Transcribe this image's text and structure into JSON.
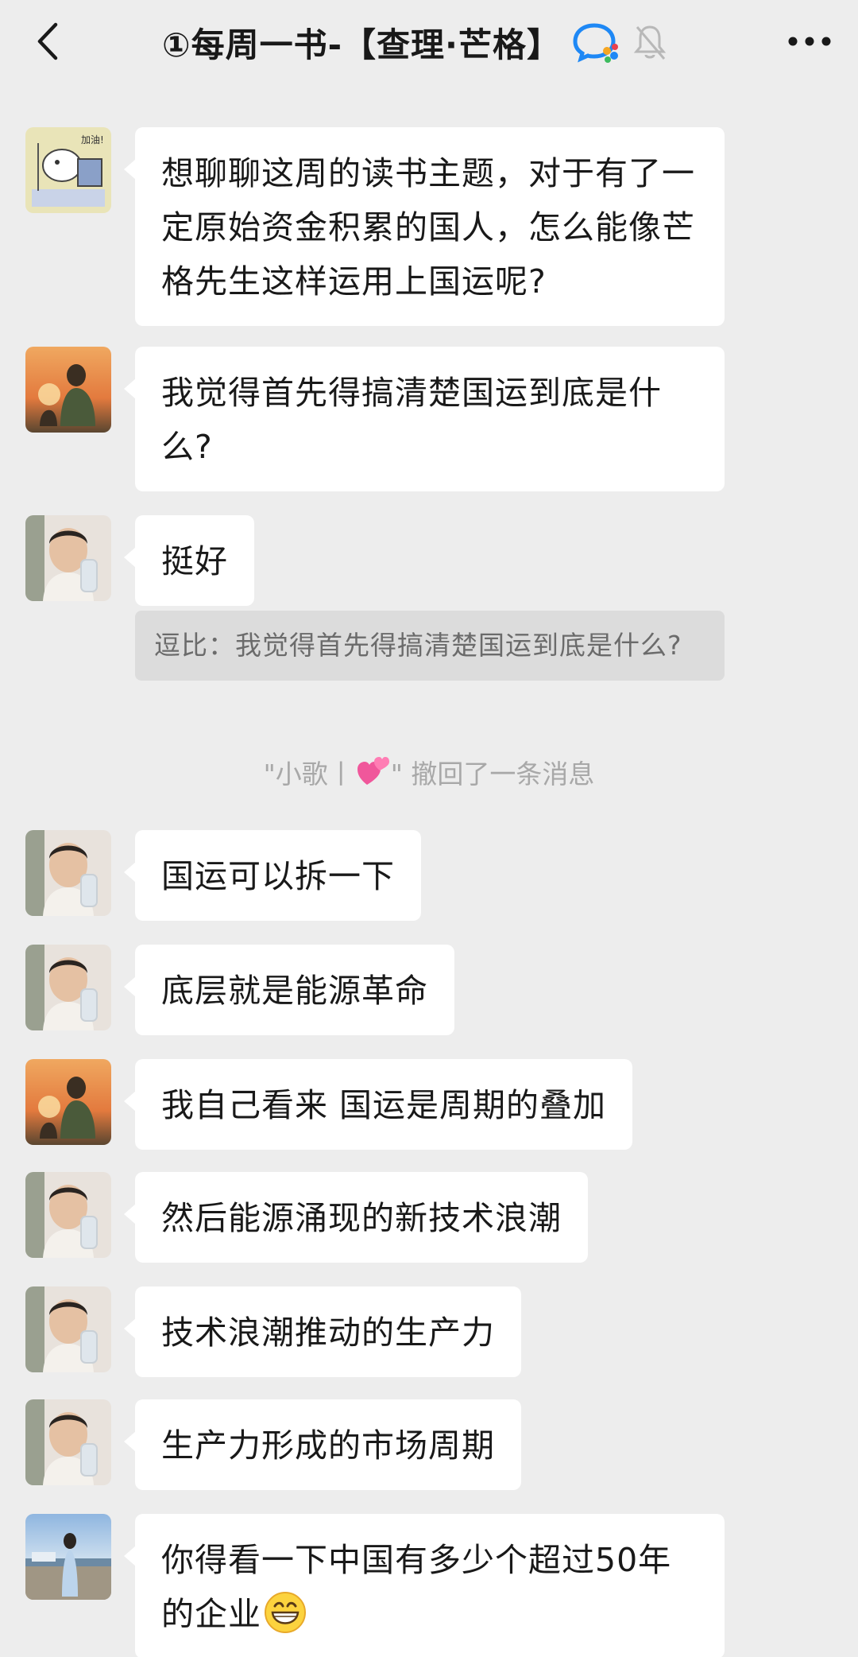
{
  "header": {
    "title": "①每周一书-【查理·芒格】",
    "back_icon": "chevron-left-icon",
    "enterprise_icon": "wecom-chat-icon",
    "mute_icon": "bell-muted-icon",
    "more_icon": "more-horizontal-icon"
  },
  "messages": [
    {
      "sender": "group-member-cartoon",
      "text": "想聊聊这周的读书主题，对于有了一定原始资金积累的国人，怎么能像芒格先生这样运用上国运呢?"
    },
    {
      "sender": "group-member-sunset",
      "text": "我觉得首先得搞清楚国运到底是什么?"
    },
    {
      "sender": "group-member-man",
      "text": "挺好",
      "quote": "逗比：我觉得首先得搞清楚国运到底是什么?"
    },
    {
      "sender": "group-member-man",
      "text": "国运可以拆一下"
    },
    {
      "sender": "group-member-man",
      "text": "底层就是能源革命"
    },
    {
      "sender": "group-member-sunset",
      "text": "我自己看来 国运是周期的叠加"
    },
    {
      "sender": "group-member-man",
      "text": "然后能源涌现的新技术浪潮"
    },
    {
      "sender": "group-member-man",
      "text": "技术浪潮推动的生产力"
    },
    {
      "sender": "group-member-man",
      "text": "生产力形成的市场周期"
    },
    {
      "sender": "group-member-woman",
      "text_before_emoji": "你得看一下中国有多少个超过50年的企业",
      "emoji": "grinning-face-emoji"
    }
  ],
  "system_notice": {
    "name_prefix": "\"小歌丨",
    "name_suffix": "\"",
    "action": " 撤回了一条消息",
    "emoji": "two-hearts-emoji"
  },
  "colors": {
    "background": "#ededed",
    "bubble": "#ffffff",
    "quote_bg": "#dcdcdc",
    "system_text": "#a8a8a8",
    "wecom_blue": "#1e88f5",
    "wecom_orange": "#f5a623"
  }
}
